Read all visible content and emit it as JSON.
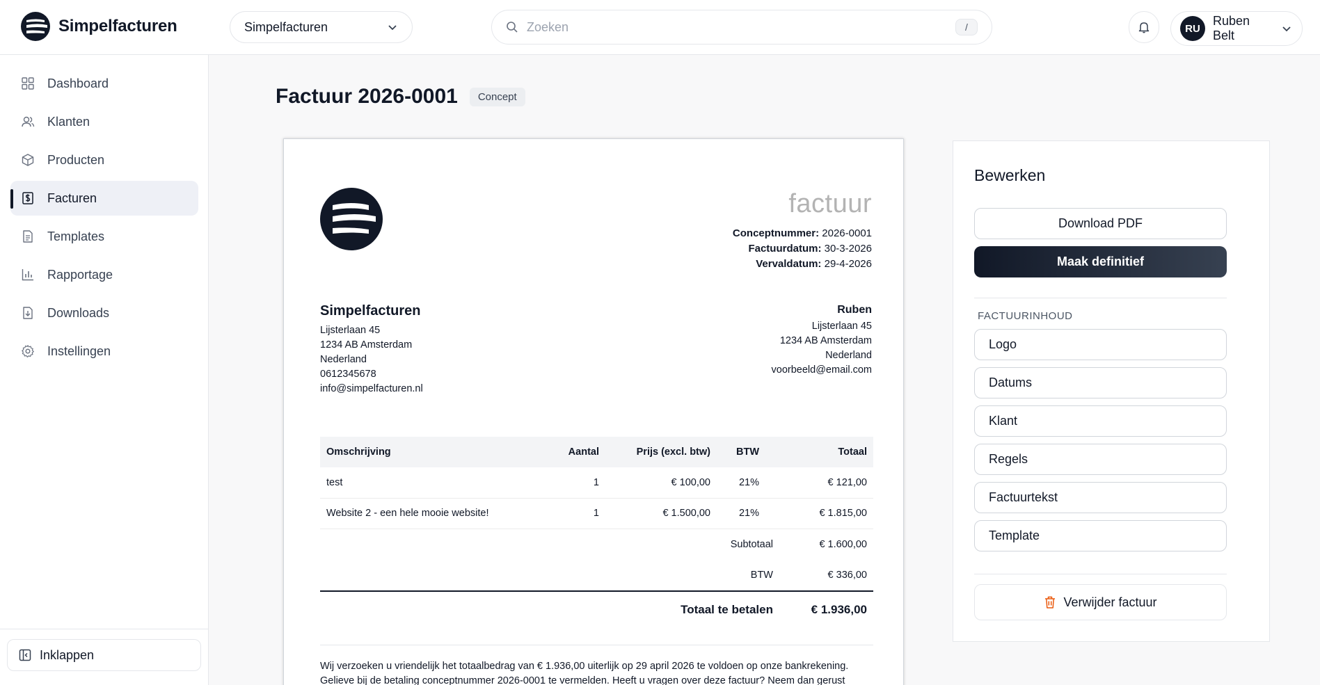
{
  "header": {
    "brand_name": "Simpelfacturen",
    "company_select": "Simpelfacturen",
    "search_placeholder": "Zoeken",
    "search_shortcut": "/",
    "user_initials": "RU",
    "user_name": "Ruben Belt"
  },
  "sidebar": {
    "items": [
      {
        "label": "Dashboard",
        "icon": "grid-icon"
      },
      {
        "label": "Klanten",
        "icon": "users-icon"
      },
      {
        "label": "Producten",
        "icon": "box-icon"
      },
      {
        "label": "Facturen",
        "icon": "invoice-icon",
        "active": true
      },
      {
        "label": "Templates",
        "icon": "document-icon"
      },
      {
        "label": "Rapportage",
        "icon": "bar-chart-icon"
      },
      {
        "label": "Downloads",
        "icon": "download-file-icon"
      },
      {
        "label": "Instellingen",
        "icon": "gear-icon"
      }
    ],
    "collapse_label": "Inklappen"
  },
  "page": {
    "title": "Factuur 2026-0001",
    "status_badge": "Concept"
  },
  "invoice": {
    "heading": "factuur",
    "meta": [
      {
        "label": "Conceptnummer:",
        "value": "2026-0001"
      },
      {
        "label": "Factuurdatum:",
        "value": "30-3-2026"
      },
      {
        "label": "Vervaldatum:",
        "value": "29-4-2026"
      }
    ],
    "sender": {
      "name": "Simpelfacturen",
      "address": "Lijsterlaan 45",
      "postal_city": "1234 AB Amsterdam",
      "country": "Nederland",
      "phone": "0612345678",
      "email": "info@simpelfacturen.nl"
    },
    "recipient": {
      "name": "Ruben",
      "address": "Lijsterlaan 45",
      "postal_city": "1234 AB Amsterdam",
      "country": "Nederland",
      "email": "voorbeeld@email.com"
    },
    "columns": [
      "Omschrijving",
      "Aantal",
      "Prijs (excl. btw)",
      "BTW",
      "Totaal"
    ],
    "rows": [
      {
        "description": "test",
        "qty": "1",
        "price": "€ 100,00",
        "vat": "21%",
        "total": "€ 121,00"
      },
      {
        "description": "Website 2 - een hele mooie website!",
        "qty": "1",
        "price": "€ 1.500,00",
        "vat": "21%",
        "total": "€ 1.815,00"
      }
    ],
    "subtotal_label": "Subtotaal",
    "subtotal_value": "€ 1.600,00",
    "vat_label": "BTW",
    "vat_value": "€ 336,00",
    "grand_label": "Totaal te betalen",
    "grand_value": "€ 1.936,00",
    "note_line1": "Wij verzoeken u vriendelijk het totaalbedrag van € 1.936,00 uiterlijk op 29 april 2026 te voldoen op onze bankrekening.",
    "note_line2": "Gelieve bij de betaling conceptnummer 2026-0001 te vermelden. Heeft u vragen over deze factuur? Neem dan gerust"
  },
  "panel": {
    "title": "Bewerken",
    "download_label": "Download PDF",
    "finalize_label": "Maak definitief",
    "section_label": "FACTUURINHOUD",
    "sections": [
      "Logo",
      "Datums",
      "Klant",
      "Regels",
      "Factuurtekst",
      "Template"
    ],
    "delete_label": "Verwijder factuur"
  },
  "colors": {
    "primary_dark": "#111827",
    "accent_delete": "#ea580c",
    "active_bg": "#eef0f6"
  }
}
